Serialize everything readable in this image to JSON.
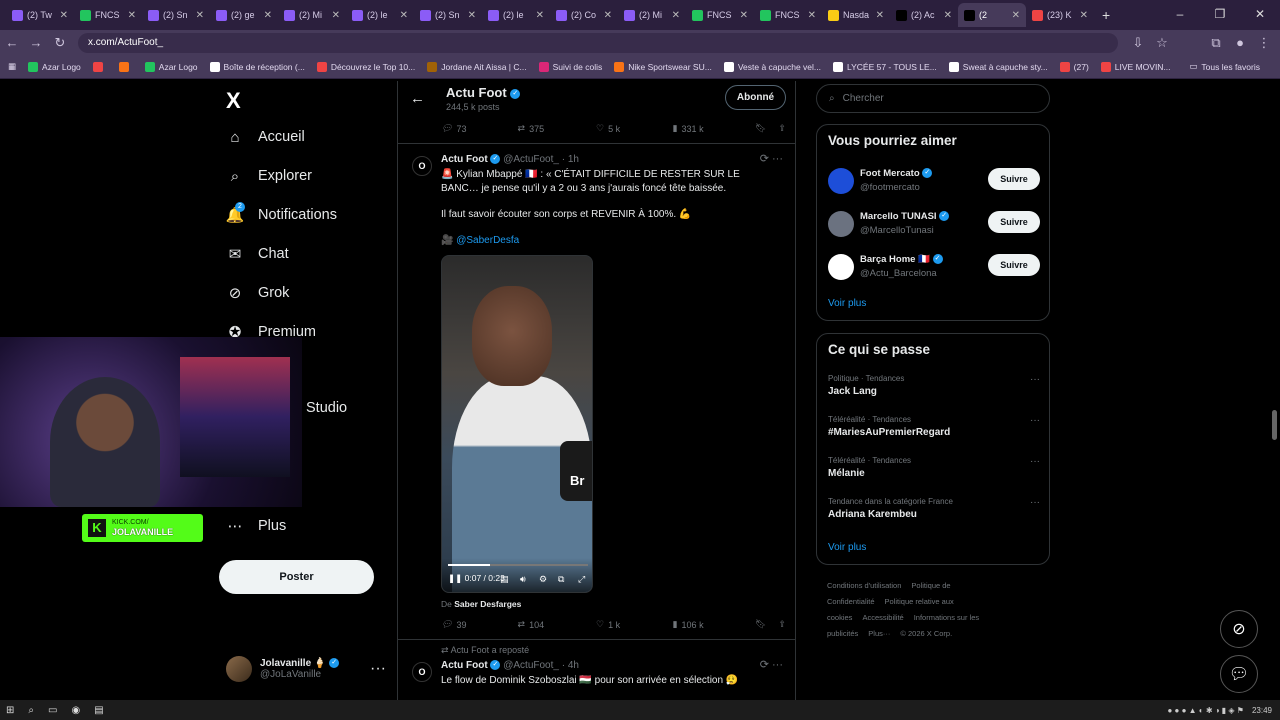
{
  "browser": {
    "tabs": [
      {
        "label": "(2) Tw",
        "color": "#8b5cf6"
      },
      {
        "label": "FNCS",
        "color": "#22c55e"
      },
      {
        "label": "(2) Sn",
        "color": "#8b5cf6"
      },
      {
        "label": "(2) ge",
        "color": "#8b5cf6"
      },
      {
        "label": "(2) Mi",
        "color": "#8b5cf6"
      },
      {
        "label": "(2) le",
        "color": "#8b5cf6"
      },
      {
        "label": "(2) Sn",
        "color": "#8b5cf6"
      },
      {
        "label": "(2) le",
        "color": "#8b5cf6"
      },
      {
        "label": "(2) Co",
        "color": "#8b5cf6"
      },
      {
        "label": "(2) Mi",
        "color": "#8b5cf6"
      },
      {
        "label": "FNCS",
        "color": "#22c55e"
      },
      {
        "label": "FNCS",
        "color": "#22c55e"
      },
      {
        "label": "Nasda",
        "color": "#facc15"
      },
      {
        "label": "(2) Ac",
        "color": "#000000"
      },
      {
        "label": "(2",
        "color": "#000000",
        "active": true
      },
      {
        "label": "(23) K",
        "color": "#ef4444"
      }
    ],
    "url": "x.com/ActuFoot_",
    "bookmarks": [
      {
        "label": "Azar Logo",
        "color": "#22c55e"
      },
      {
        "label": "",
        "color": "#ef4444"
      },
      {
        "label": "",
        "color": "#f97316"
      },
      {
        "label": "Azar Logo",
        "color": "#22c55e"
      },
      {
        "label": "Boîte de réception (...",
        "color": "#ffffff"
      },
      {
        "label": "Découvrez le Top 10...",
        "color": "#ef4444"
      },
      {
        "label": "Jordane Ait Aissa | C...",
        "color": "#a16207"
      },
      {
        "label": "Suivi de colis",
        "color": "#db2777"
      },
      {
        "label": "Nike Sportswear SU...",
        "color": "#f97316"
      },
      {
        "label": "Veste à capuche vel...",
        "color": "#ffffff"
      },
      {
        "label": "LYCÉE 57 - TOUS LE...",
        "color": "#ffffff"
      },
      {
        "label": "Sweat à capuche sty...",
        "color": "#ffffff"
      },
      {
        "label": "(27)",
        "color": "#ef4444"
      },
      {
        "label": "LIVE MOVIN...",
        "color": "#ef4444"
      }
    ],
    "all_favorites": "Tous les favoris"
  },
  "sidebar": {
    "logo": "X",
    "items": [
      {
        "label": "Accueil",
        "icon": "⌂"
      },
      {
        "label": "Explorer",
        "icon": "⌕"
      },
      {
        "label": "Notifications",
        "icon": "🔔",
        "badge": "2"
      },
      {
        "label": "Chat",
        "icon": "✉"
      },
      {
        "label": "Grok",
        "icon": "⊘"
      },
      {
        "label": "Premium",
        "icon": "✪"
      },
      {
        "label": "Studio",
        "icon": ""
      },
      {
        "label": "Plus",
        "icon": "⋯"
      }
    ],
    "post_button": "Poster",
    "user": {
      "name": "Jolavanille 🍦",
      "handle": "@JoLaVanille"
    }
  },
  "overlay": {
    "kick_line1": "KICK.COM/",
    "kick_line2": "JOLAVANILLE"
  },
  "header": {
    "title": "Actu Foot",
    "posts": "244,5 k posts",
    "follow_state": "Abonné"
  },
  "top_actions": {
    "replies": "73",
    "reposts": "375",
    "likes": "5 k",
    "views": "331 k"
  },
  "tweet1": {
    "author": "Actu Foot",
    "handle": "@ActuFoot_",
    "time": "· 1h",
    "line1": "🚨 Kylian Mbappé 🇫🇷 : « C'ÉTAIT DIFFICILE DE RESTER SUR LE BANC… je pense qu'il y a 2 ou 3 ans j'aurais foncé tête baissée.",
    "line2": "Il faut savoir écouter son corps et REVENIR À 100%. 💪",
    "credit_prefix": "🎥",
    "credit_link": "@SaberDesfa",
    "video_time": "0:07 / 0:23",
    "video_progress": 0.3,
    "from_prefix": "De",
    "from_name": "Saber Desfarges",
    "replies": "39",
    "reposts": "104",
    "likes": "1 k",
    "views": "106 k"
  },
  "tweet2": {
    "repost_note": "Actu Foot a reposté",
    "author": "Actu Foot",
    "handle": "@ActuFoot_",
    "time": "· 4h",
    "text": "Le flow de Dominik Szoboszlai 🇭🇺 pour son arrivée en sélection 😮‍💨"
  },
  "search": {
    "placeholder": "Chercher"
  },
  "suggestions": {
    "title": "Vous pourriez aimer",
    "items": [
      {
        "name": "Foot Mercato",
        "handle": "@footmercato",
        "button": "Suivre",
        "color": "#1d4ed8"
      },
      {
        "name": "Marcello TUNASI",
        "handle": "@MarcelloTunasi",
        "button": "Suivre",
        "color": "#6b7280"
      },
      {
        "name": "Barça Home 🇫🇷",
        "handle": "@Actu_Barcelona",
        "button": "Suivre",
        "color": "#ffffff"
      }
    ],
    "more": "Voir plus"
  },
  "trends": {
    "title": "Ce qui se passe",
    "items": [
      {
        "context": "Politique · Tendances",
        "name": "Jack Lang"
      },
      {
        "context": "Téléréalité · Tendances",
        "name": "#MariesAuPremierRegard"
      },
      {
        "context": "Téléréalité · Tendances",
        "name": "Mélanie"
      },
      {
        "context": "Tendance dans la catégorie France",
        "name": "Adriana Karembeu"
      }
    ],
    "more": "Voir plus"
  },
  "footer": {
    "links": [
      "Conditions d'utilisation",
      "Politique de Confidentialité",
      "Politique relative aux cookies",
      "Accessibilité",
      "Informations sur les publicités",
      "Plus···",
      "© 2026 X Corp."
    ]
  },
  "taskbar": {
    "time": "23:49"
  }
}
